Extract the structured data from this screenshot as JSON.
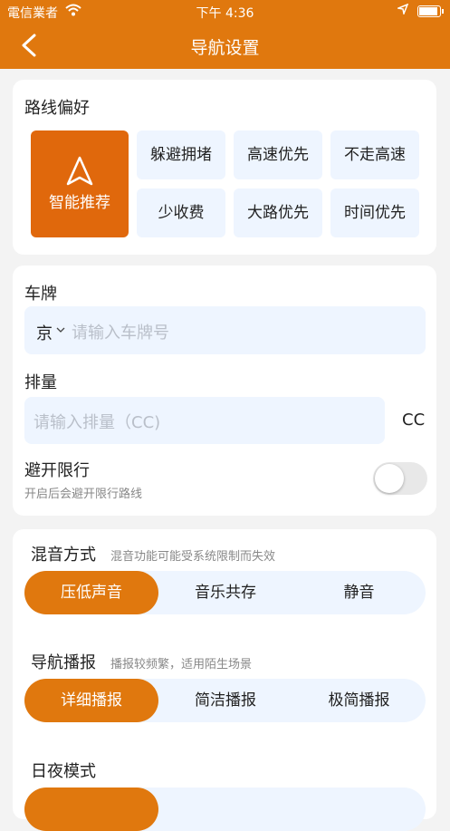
{
  "status": {
    "carrier": "電信業者",
    "time": "下午 4:36"
  },
  "header": {
    "title": "导航设置"
  },
  "route": {
    "title": "路线偏好",
    "smart_label": "智能推荐",
    "options": [
      "躲避拥堵",
      "高速优先",
      "不走高速",
      "少收费",
      "大路优先",
      "时间优先"
    ]
  },
  "vehicle": {
    "plate_title": "车牌",
    "province": "京",
    "plate_placeholder": "请输入车牌号",
    "displacement_title": "排量",
    "displacement_placeholder": "请输入排量（CC)",
    "unit": "CC",
    "restrict_title": "避开限行",
    "restrict_note": "开启后会避开限行路线"
  },
  "audio": {
    "mix_title": "混音方式",
    "mix_note": "混音功能可能受系统限制而失效",
    "mix_options": [
      "压低声音",
      "音乐共存",
      "静音"
    ],
    "broadcast_title": "导航播报",
    "broadcast_note": "播报较频繁，适用陌生场景",
    "broadcast_options": [
      "详细播报",
      "简洁播报",
      "极简播报"
    ],
    "daynight_title": "日夜模式"
  },
  "colors": {
    "accent": "#e0780e",
    "chip_bg": "#eef5ff"
  }
}
